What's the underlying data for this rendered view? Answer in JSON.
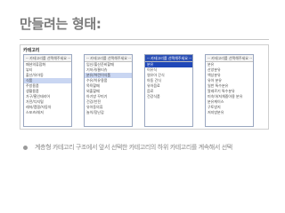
{
  "slide": {
    "title": "만들려는 형태:",
    "bullet": "계층형 카테고리 구조에서 앞서 선택한 카테고리의 하위 카테고리를 계속해서 선택"
  },
  "screenshot": {
    "label": "카테고리",
    "columns": [
      {
        "header": "-- 카테고리를 선택해주세요 --",
        "active": false,
        "items": [
          "패션의류잡화",
          "뷰티",
          "출산/유아동",
          "식품",
          "주방용품",
          "생활용품",
          "가구/홈인테리어",
          "가전/디지털",
          "레저/캠핑/자동차",
          "스포츠/레저"
        ],
        "selected_index": 3
      },
      {
        "header": "-- 카테고리를 선택해주세요 --",
        "active": false,
        "items": [
          "임신/출산준비할때",
          "기저귀/물티슈",
          "분유/어린이식품",
          "수유/이유용품",
          "목욕할때",
          "외출할때",
          "아기방 꾸미기",
          "건강/안전",
          "유아동의류",
          "놀이/장난감"
        ],
        "selected_index": 2
      },
      {
        "header": "-- 카테고리를 선택해주세요 --",
        "active": true,
        "items": [
          "분유",
          "이유식",
          "영유아 간식",
          "아동 간식",
          "유아음료",
          "음료",
          "건강식품"
        ],
        "selected_index": 0
      },
      {
        "header": "-- 카테고리를 선택해주세요 --",
        "active": false,
        "items": [
          "분유",
          "산양분유",
          "액상분유",
          "유아 분유",
          "일반 특수분유",
          "알레르기 특수분유",
          "미숙아/저체중아용 분유",
          "분유케이스",
          "구토방지",
          "저지방분유"
        ],
        "selected_index": -1
      }
    ]
  }
}
